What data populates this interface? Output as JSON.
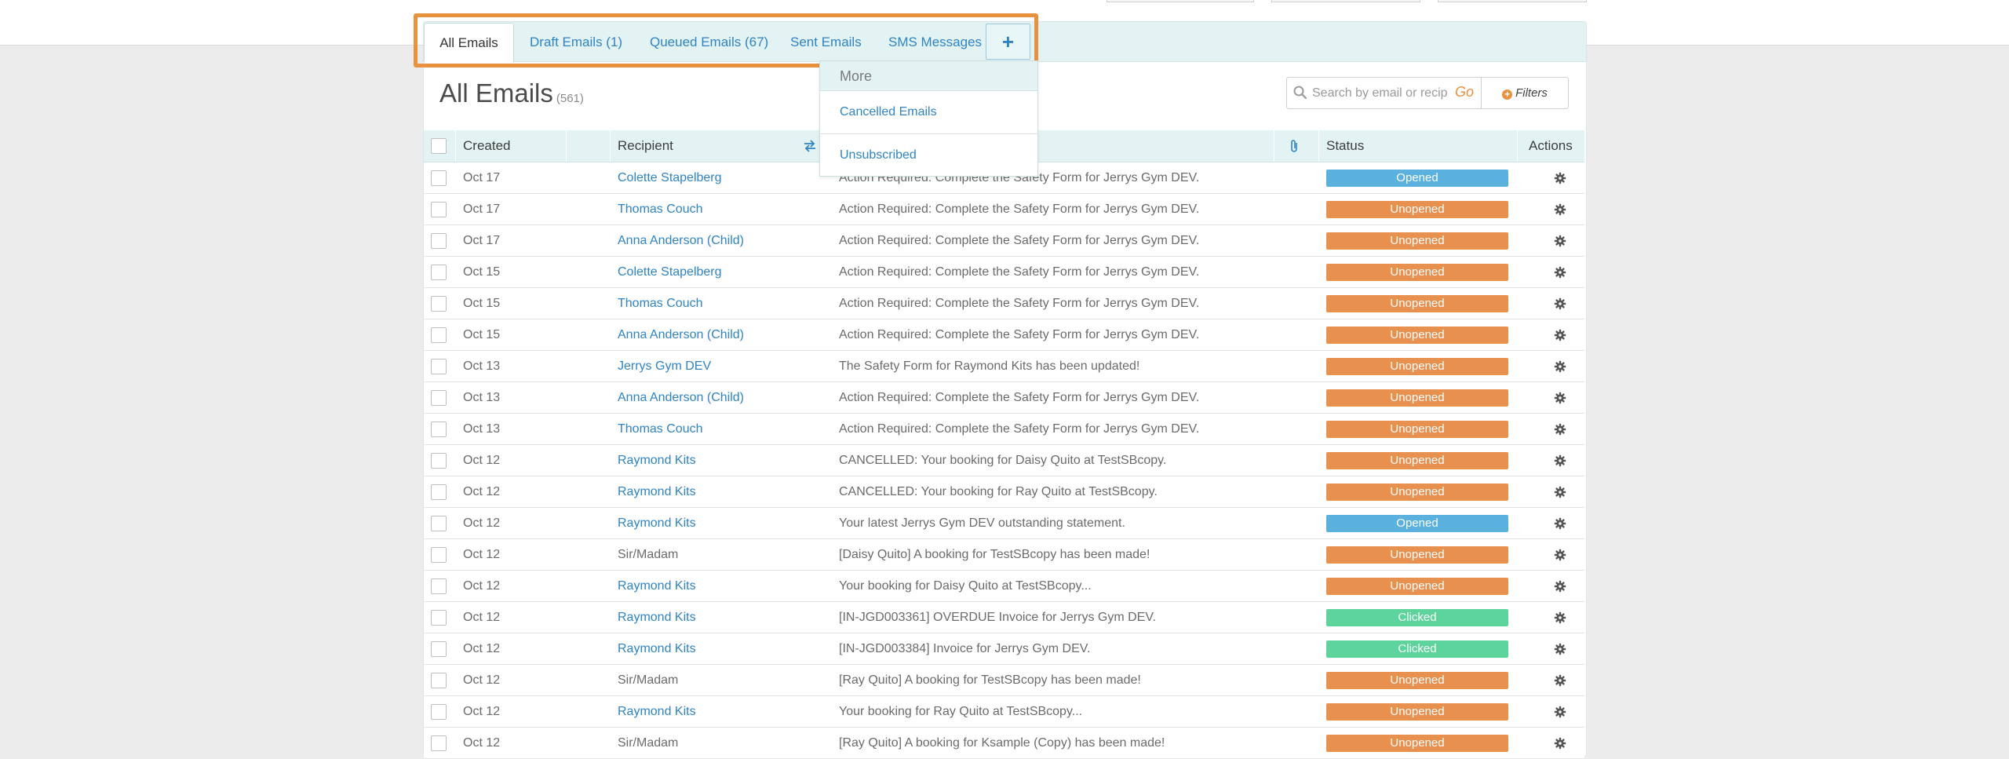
{
  "tabs": [
    {
      "label": "All Emails",
      "active": true
    },
    {
      "label": "Draft Emails (1)"
    },
    {
      "label": "Queued Emails (67)"
    },
    {
      "label": "Sent Emails"
    },
    {
      "label": "SMS Messages"
    }
  ],
  "tab_more_glyph": "+",
  "page": {
    "title": "All Emails",
    "count": "(561)"
  },
  "search": {
    "placeholder": "Search by email or recipient",
    "go_label": "Go",
    "filters_label": "Filters"
  },
  "table": {
    "headers": {
      "created": "Created",
      "recipient": "Recipient",
      "subject": "",
      "status": "Status",
      "actions": "Actions"
    },
    "rows": [
      {
        "date": "Oct 17",
        "recipient": "Colette Stapelberg",
        "subject": "Action Required: Complete the Safety Form for Jerrys Gym DEV.",
        "status": "Opened"
      },
      {
        "date": "Oct 17",
        "recipient": "Thomas Couch",
        "subject": "Action Required: Complete the Safety Form for Jerrys Gym DEV.",
        "status": "Unopened"
      },
      {
        "date": "Oct 17",
        "recipient": "Anna Anderson (Child)",
        "subject": "Action Required: Complete the Safety Form for Jerrys Gym DEV.",
        "status": "Unopened"
      },
      {
        "date": "Oct 15",
        "recipient": "Colette Stapelberg",
        "subject": "Action Required: Complete the Safety Form for Jerrys Gym DEV.",
        "status": "Unopened"
      },
      {
        "date": "Oct 15",
        "recipient": "Thomas Couch",
        "subject": "Action Required: Complete the Safety Form for Jerrys Gym DEV.",
        "status": "Unopened"
      },
      {
        "date": "Oct 15",
        "recipient": "Anna Anderson (Child)",
        "subject": "Action Required: Complete the Safety Form for Jerrys Gym DEV.",
        "status": "Unopened"
      },
      {
        "date": "Oct 13",
        "recipient": "Jerrys Gym DEV",
        "subject": "The Safety Form for Raymond Kits has been updated!",
        "status": "Unopened"
      },
      {
        "date": "Oct 13",
        "recipient": "Anna Anderson (Child)",
        "subject": "Action Required: Complete the Safety Form for Jerrys Gym DEV.",
        "status": "Unopened"
      },
      {
        "date": "Oct 13",
        "recipient": "Thomas Couch",
        "subject": "Action Required: Complete the Safety Form for Jerrys Gym DEV.",
        "status": "Unopened"
      },
      {
        "date": "Oct 12",
        "recipient": "Raymond Kits",
        "subject": "CANCELLED: Your booking for Daisy Quito at TestSBcopy.",
        "status": "Unopened"
      },
      {
        "date": "Oct 12",
        "recipient": "Raymond Kits",
        "subject": "CANCELLED: Your booking for Ray Quito at TestSBcopy.",
        "status": "Unopened"
      },
      {
        "date": "Oct 12",
        "recipient": "Raymond Kits",
        "subject": "Your latest Jerrys Gym DEV outstanding statement.",
        "status": "Opened"
      },
      {
        "date": "Oct 12",
        "recipient": "Sir/Madam",
        "subject": "[Daisy Quito] A booking for TestSBcopy has been made!",
        "status": "Unopened",
        "plain": true
      },
      {
        "date": "Oct 12",
        "recipient": "Raymond Kits",
        "subject": "Your booking for Daisy Quito at TestSBcopy...",
        "status": "Unopened"
      },
      {
        "date": "Oct 12",
        "recipient": "Raymond Kits",
        "subject": "[IN-JGD003361] OVERDUE Invoice for Jerrys Gym DEV.",
        "status": "Clicked"
      },
      {
        "date": "Oct 12",
        "recipient": "Raymond Kits",
        "subject": "[IN-JGD003384] Invoice for Jerrys Gym DEV.",
        "status": "Clicked"
      },
      {
        "date": "Oct 12",
        "recipient": "Sir/Madam",
        "subject": "[Ray Quito] A booking for TestSBcopy has been made!",
        "status": "Unopened",
        "plain": true
      },
      {
        "date": "Oct 12",
        "recipient": "Raymond Kits",
        "subject": "Your booking for Ray Quito at TestSBcopy...",
        "status": "Unopened"
      },
      {
        "date": "Oct 12",
        "recipient": "Sir/Madam",
        "subject": "[Ray Quito] A booking for Ksample (Copy) has been made!",
        "status": "Unopened",
        "plain": true
      }
    ]
  },
  "dropdown": {
    "header": "More",
    "items": [
      "Cancelled Emails",
      "Unsubscribed"
    ]
  },
  "status_colors": {
    "Opened": "#5ab1de",
    "Unopened": "#e8914f",
    "Clicked": "#5dd49c"
  },
  "accent_color": "#2f84c3",
  "highlight_color": "#e8913f",
  "icons": {
    "search": "search-icon",
    "swap": "swap-arrows-icon",
    "attachment": "paperclip-icon",
    "actions": "gear-icon",
    "filters": "plus-circle-icon"
  }
}
